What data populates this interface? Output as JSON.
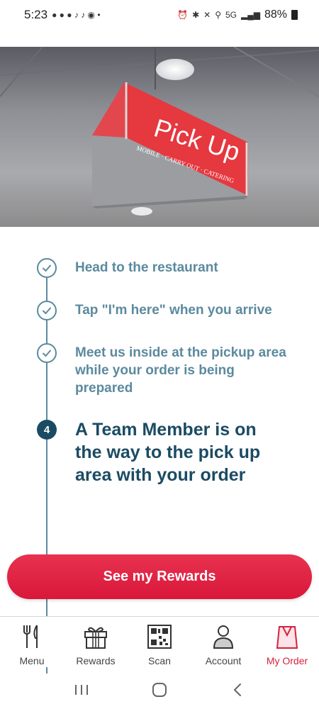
{
  "status_bar": {
    "time": "5:23",
    "network": "5G",
    "battery": "88%"
  },
  "hero": {
    "sign_title": "Pick Up",
    "sign_subtitle": "MOBILE · CARRY OUT · CATERING"
  },
  "steps": [
    {
      "text": "Head to the restaurant",
      "state": "done"
    },
    {
      "text": "Tap \"I'm here\" when you arrive",
      "state": "done"
    },
    {
      "text": "Meet us inside at the pickup area while your order is being prepared",
      "state": "done"
    },
    {
      "number": "4",
      "text": "A Team Member is on the way to the pick up area with your order",
      "state": "active"
    }
  ],
  "rewards_button": {
    "label": "See my Rewards"
  },
  "bottom_nav": [
    {
      "label": "Menu",
      "icon": "fork-knife-icon"
    },
    {
      "label": "Rewards",
      "icon": "gift-icon"
    },
    {
      "label": "Scan",
      "icon": "qr-code-icon"
    },
    {
      "label": "Account",
      "icon": "person-icon"
    },
    {
      "label": "My Order",
      "icon": "cup-icon",
      "active": true
    }
  ],
  "colors": {
    "accent": "#d6213d",
    "step_done": "#5b8a9e",
    "step_active": "#1b4b63"
  }
}
